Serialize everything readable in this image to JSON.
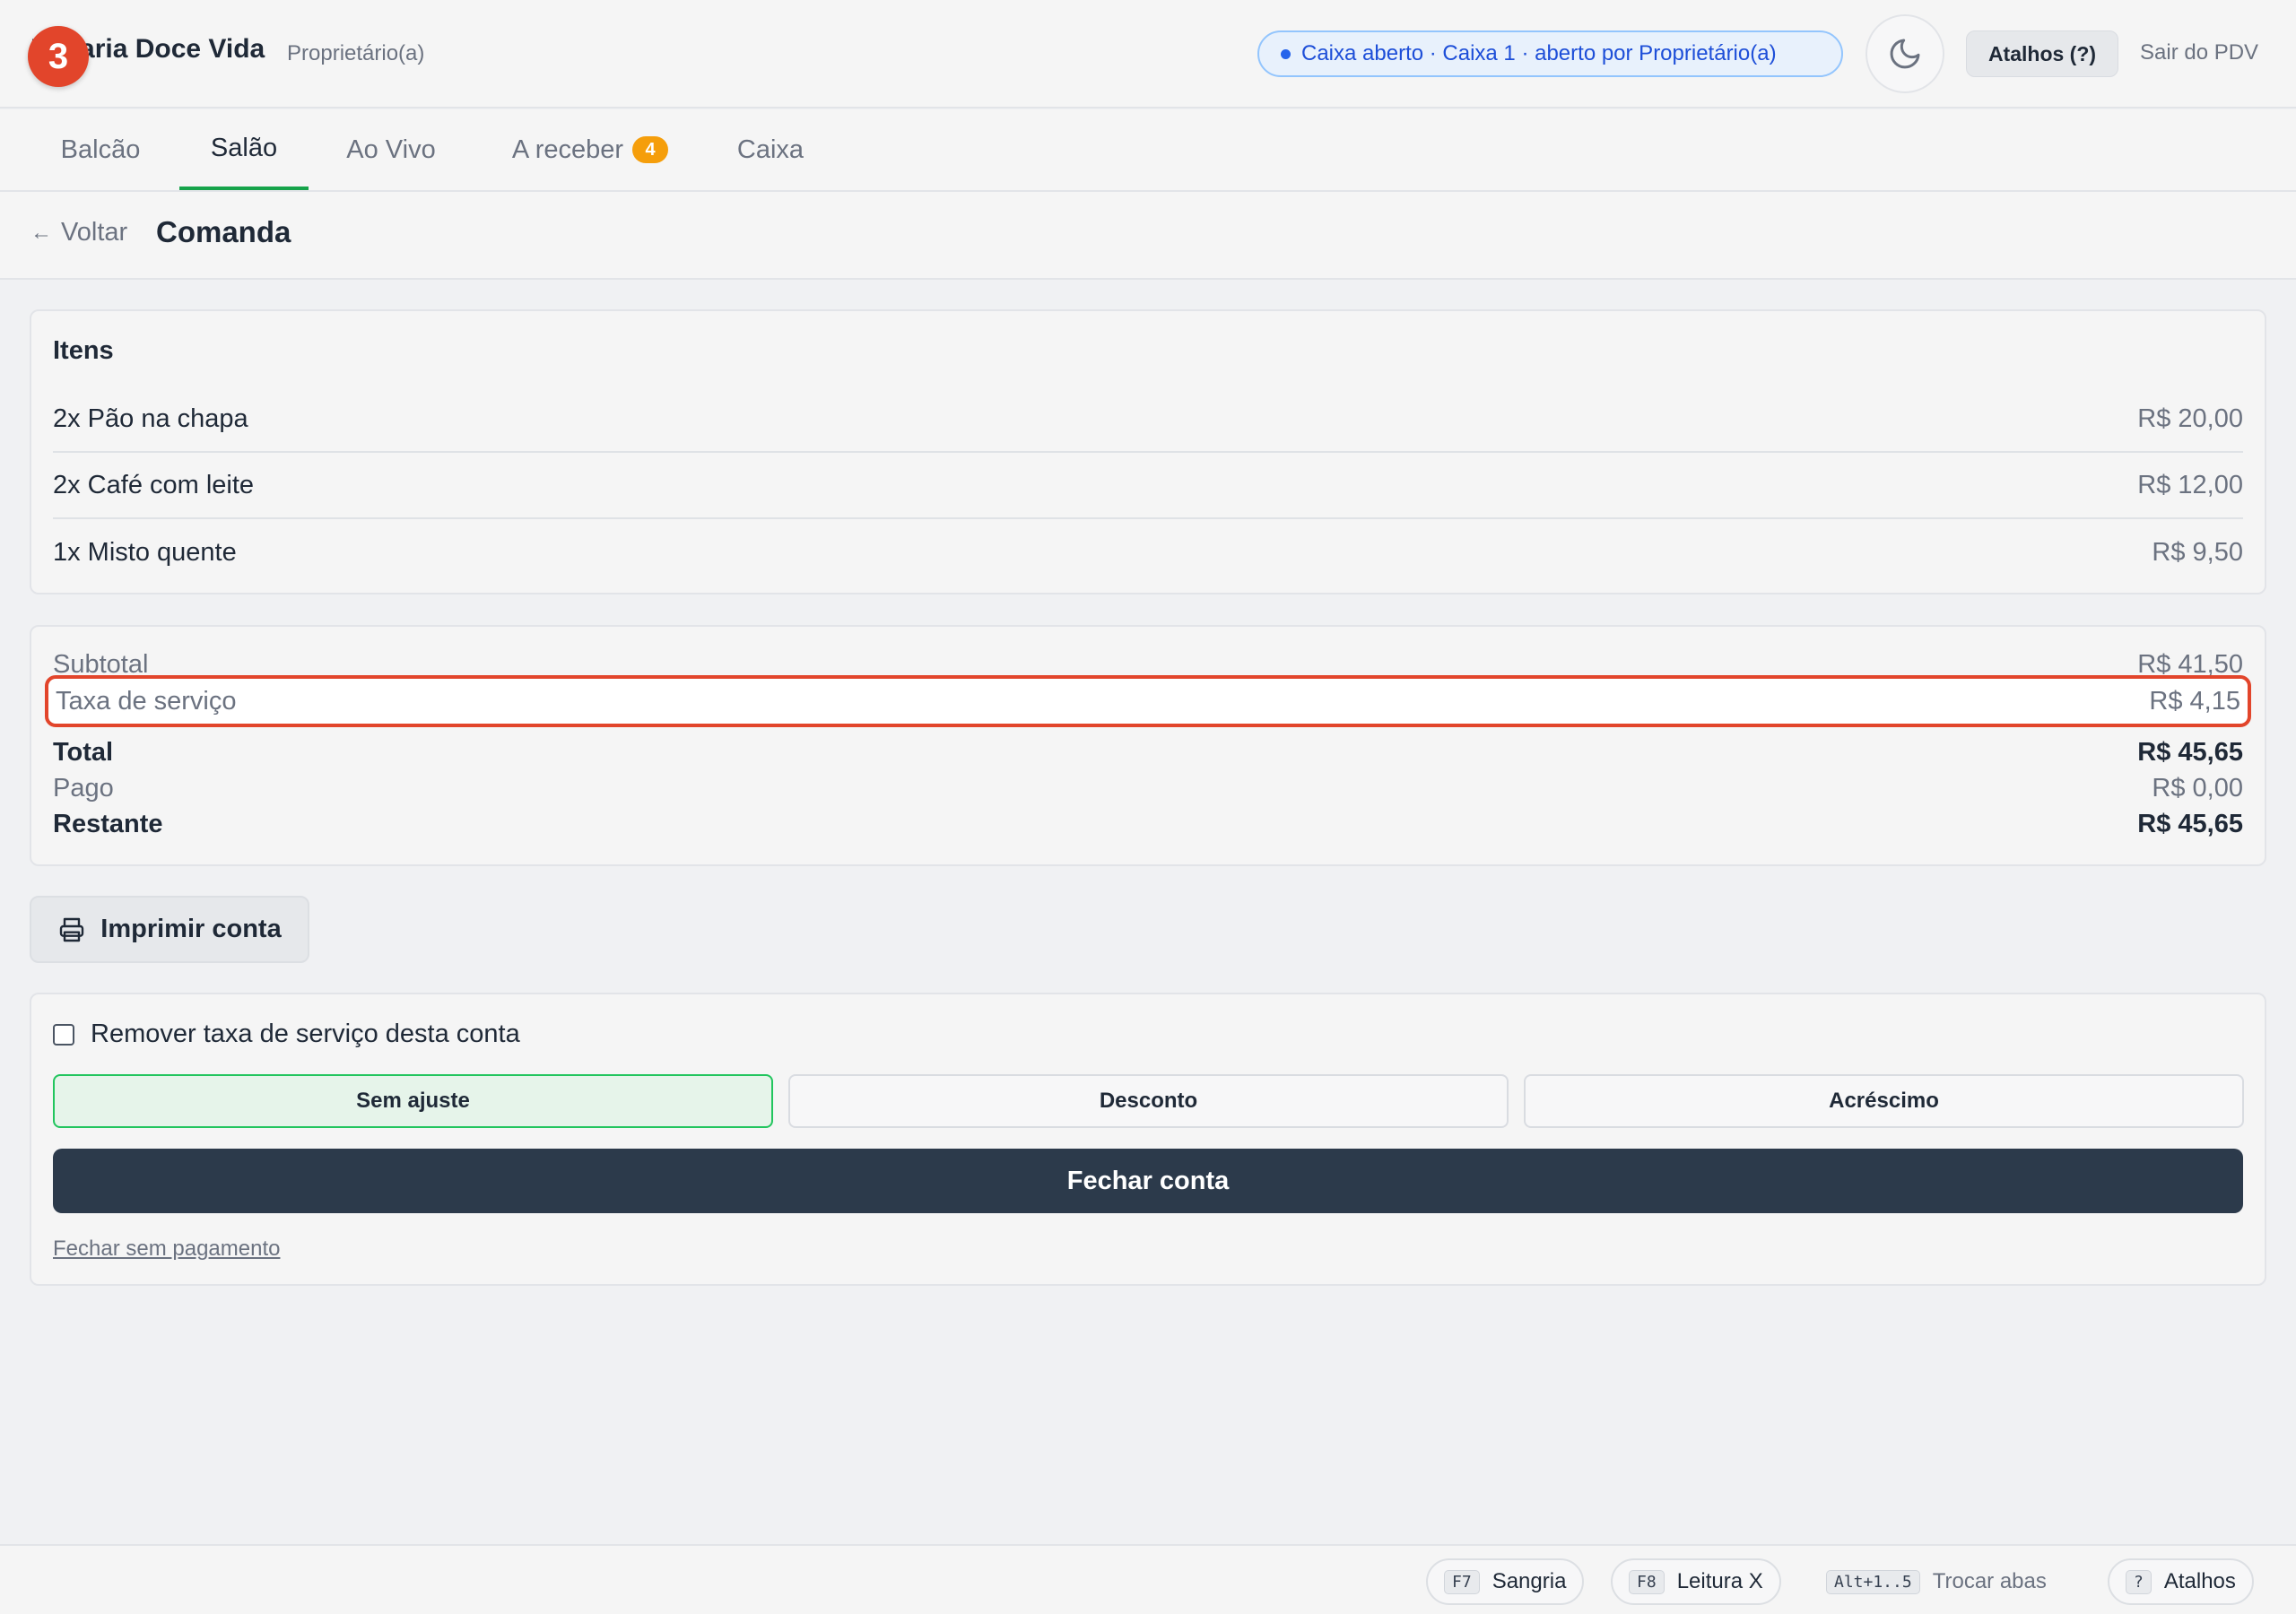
{
  "header": {
    "step_badge": "3",
    "brand": "Padaria Doce Vida",
    "role": "Proprietário(a)",
    "status": "Caixa aberto · Caixa 1 · aberto por Proprietário(a)",
    "shortcuts_label": "Atalhos (?)",
    "logout_label": "Sair do PDV",
    "theme_icon": "moon-icon"
  },
  "tabs": [
    {
      "label": "Balcão"
    },
    {
      "label": "Salão",
      "active": true
    },
    {
      "label": "Ao Vivo"
    },
    {
      "label": "A receber",
      "badge": "4"
    },
    {
      "label": "Caixa"
    }
  ],
  "subheader": {
    "back_arrow": "←",
    "back_label": "Voltar",
    "title": "Comanda"
  },
  "items": {
    "title": "Itens",
    "rows": [
      {
        "name": "2x Pão na chapa",
        "price": "R$ 20,00"
      },
      {
        "name": "2x Café com leite",
        "price": "R$ 12,00"
      },
      {
        "name": "1x Misto quente",
        "price": "R$ 9,50"
      }
    ]
  },
  "totals": {
    "subtotal_label": "Subtotal",
    "subtotal_value": "R$ 41,50",
    "service_label": "Taxa de serviço",
    "service_value": "R$ 4,15",
    "total_label": "Total",
    "total_value": "R$ 45,65",
    "paid_label": "Pago",
    "paid_value": "R$ 0,00",
    "remaining_label": "Restante",
    "remaining_value": "R$ 45,65"
  },
  "actions": {
    "print_label": "Imprimir conta",
    "remove_fee_label": "Remover taxa de serviço desta conta",
    "adjust_none": "Sem ajuste",
    "adjust_discount": "Desconto",
    "adjust_surcharge": "Acréscimo",
    "close_label": "Fechar conta",
    "close_without_payment": "Fechar sem pagamento"
  },
  "footer": {
    "sangria_key": "F7",
    "sangria_label": "Sangria",
    "leitura_key": "F8",
    "leitura_label": "Leitura X",
    "tabs_key": "Alt+1..5",
    "tabs_label": "Trocar abas",
    "help_key": "?",
    "help_label": "Atalhos"
  },
  "colors": {
    "accent_green": "#16a34a",
    "highlight_red": "#e2452b",
    "primary_dark": "#2c3a4b",
    "badge_orange": "#f59e0b",
    "status_blue": "#1d4ed8"
  }
}
